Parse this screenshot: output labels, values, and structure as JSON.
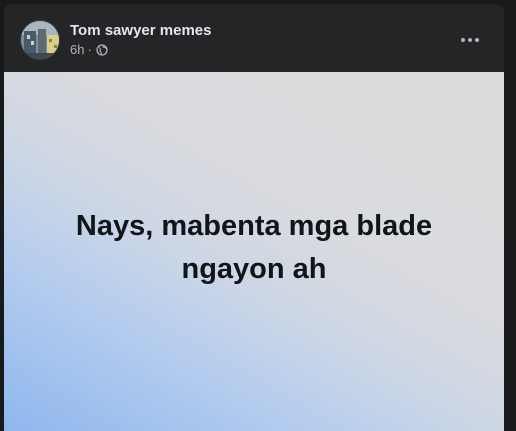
{
  "post": {
    "page_name": "Tom sawyer memes",
    "time": "6h",
    "separator": "·",
    "audience_icon": "globe-icon",
    "more_icon": "more-options-icon",
    "text": "Nays, mabenta mga blade ngayon ah",
    "background_gradient": [
      "#8fb7ee",
      "#dcdcde"
    ]
  },
  "colors": {
    "card_background": "#242526",
    "page_background": "#18191a",
    "name_text": "#e4e6eb",
    "meta_text": "#b0b3b8",
    "post_text": "#111418"
  }
}
